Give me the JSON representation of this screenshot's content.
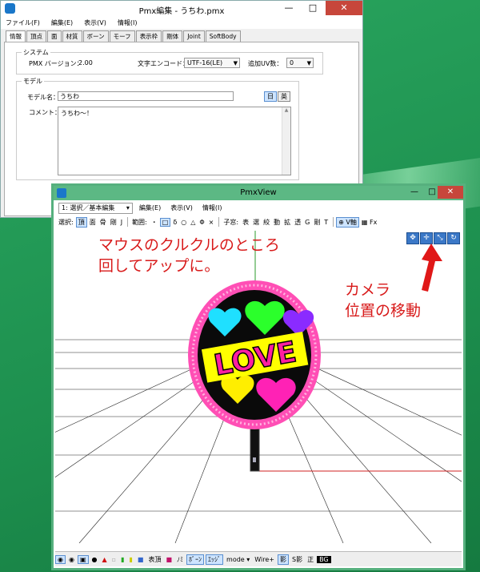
{
  "pmx_editor": {
    "title": "Pmx編集 - うちわ.pmx",
    "menu": [
      "ファイル(F)",
      "編集(E)",
      "表示(V)",
      "情報(I)"
    ],
    "tabs": [
      "情報",
      "頂点",
      "面",
      "材質",
      "ボーン",
      "モーフ",
      "表示枠",
      "剛体",
      "Joint",
      "SoftBody"
    ],
    "system": {
      "group_label": "システム",
      "version_label": "PMX バージョン：",
      "version_value": "2.00",
      "encode_label": "文字エンコード：",
      "encode_value": "UTF-16(LE)",
      "uv_label": "追加UV数：",
      "uv_value": "0"
    },
    "model": {
      "group_label": "モデル",
      "name_label": "モデル名：",
      "name_value": "うちわ",
      "lang_jp": "日",
      "lang_en": "英",
      "comment_label": "コメント：",
      "comment_value": "うちわ～！"
    }
  },
  "pmx_view": {
    "title": "PmxView",
    "mode_select": "1: 選択／基本編集",
    "menu": [
      "編集(E)",
      "表示(V)",
      "情報(I)"
    ],
    "toolbar": [
      "選択:",
      "頂",
      "面",
      "骨",
      "剛",
      "J",
      "範囲:",
      "・",
      "□",
      "δ",
      "○",
      "△",
      "Φ",
      "×",
      "子窓:",
      "表",
      "選",
      "絞",
      "動",
      "拡",
      "透",
      "G",
      "剛",
      "T",
      "V軸",
      "Fx"
    ],
    "camera_icons": [
      "move-xy-icon",
      "move-xz-icon",
      "zoom-icon",
      "rotate-icon"
    ],
    "annotations": {
      "wheel_line1": "マウスのクルクルのところ",
      "wheel_line2": "回してアップに。",
      "camera_line1": "カメラ",
      "camera_line2": "位置の移動"
    },
    "fan_label": "LOVE",
    "statusbar": [
      "表頂",
      "ﾉﾐ",
      "ﾎﾞｰﾝ",
      "ｴｯｼﾞ",
      "mode ▾",
      "Wire+",
      "影",
      "S影",
      "正",
      "BG"
    ]
  },
  "colors": {
    "annotation_red": "#d81a1a",
    "desktop_green": "#1f9a55",
    "title_green": "#5cb884",
    "fan_pink": "#ff2bb0",
    "fan_black": "#0a0a0a",
    "love_yellow": "#ffff00",
    "love_magenta": "#ff1ea0"
  }
}
